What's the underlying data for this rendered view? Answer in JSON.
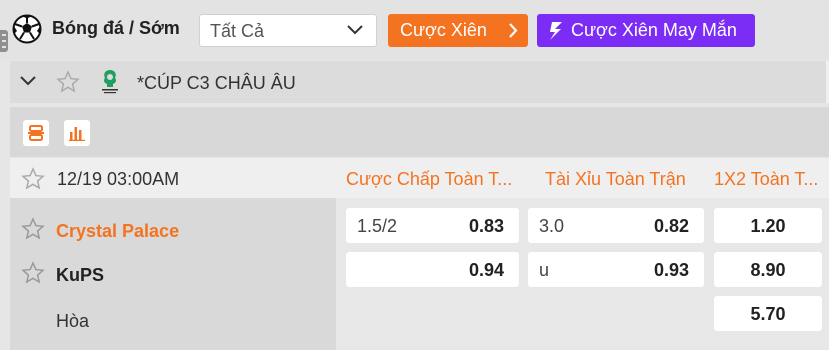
{
  "header": {
    "sport_title": "Bóng đá / Sớm",
    "market_select": {
      "value": "Tất Cả"
    },
    "parlay_button": "Cược Xiên",
    "lucky_parlay_button": "Cược Xiên May Mắn"
  },
  "league": {
    "name": "*CÚP C3 CHÂU ÂU"
  },
  "match": {
    "datetime": "12/19 03:00AM",
    "columns": {
      "handicap": "Cược Chấp Toàn T...",
      "over_under": "Tài Xỉu Toàn Trận",
      "one_x_two": "1X2 Toàn T..."
    },
    "teams": {
      "home": "Crystal Palace",
      "away": "KuPS",
      "draw": "Hòa"
    },
    "odds": {
      "handicap": {
        "home_line": "1.5/2",
        "home_price": "0.83",
        "away_line": "",
        "away_price": "0.94"
      },
      "over_under": {
        "over_line": "3.0",
        "over_price": "0.82",
        "under_line": "u",
        "under_price": "0.93"
      },
      "one_x_two": {
        "home": "1.20",
        "away": "8.90",
        "draw": "5.70"
      }
    }
  },
  "colors": {
    "accent_orange": "#f47321",
    "lucky_purple": "#7b2cf5"
  },
  "icons": [
    "soccer-ball-icon",
    "chevron-down-icon",
    "chevron-right-icon",
    "star-icon",
    "conference-league-logo",
    "list-view-icon",
    "stats-icon"
  ]
}
